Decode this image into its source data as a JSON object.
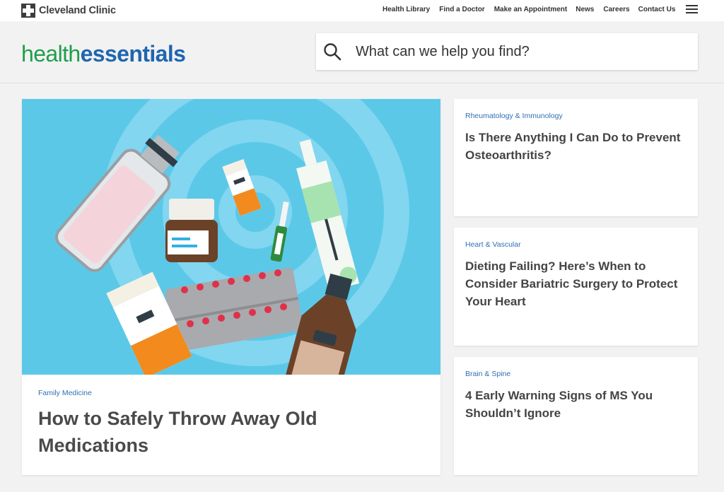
{
  "topbar": {
    "logo_text": "Cleveland Clinic",
    "nav": [
      "Health Library",
      "Find a Doctor",
      "Make an Appointment",
      "News",
      "Careers",
      "Contact Us"
    ]
  },
  "brand": {
    "part1": "health",
    "part2": "essentials"
  },
  "search": {
    "placeholder": "What can we help you find?",
    "value": ""
  },
  "featured": {
    "category": "Family Medicine",
    "title": "How to Safely Throw Away Old Medications"
  },
  "side_articles": [
    {
      "category": "Rheumatology & Immunology",
      "title": "Is There Anything I Can Do to Prevent Osteoarthritis?"
    },
    {
      "category": "Heart & Vascular",
      "title": "Dieting Failing? Here’s When to Consider Bariatric Surgery to Protect Your Heart"
    },
    {
      "category": "Brain & Spine",
      "title": "4 Early Warning Signs of MS You Shouldn’t Ignore"
    }
  ],
  "colors": {
    "brand_green": "#1f9e4c",
    "brand_blue": "#1f66b1",
    "category_blue": "#2f6fb3",
    "hero_background": "#5cc8e8"
  }
}
